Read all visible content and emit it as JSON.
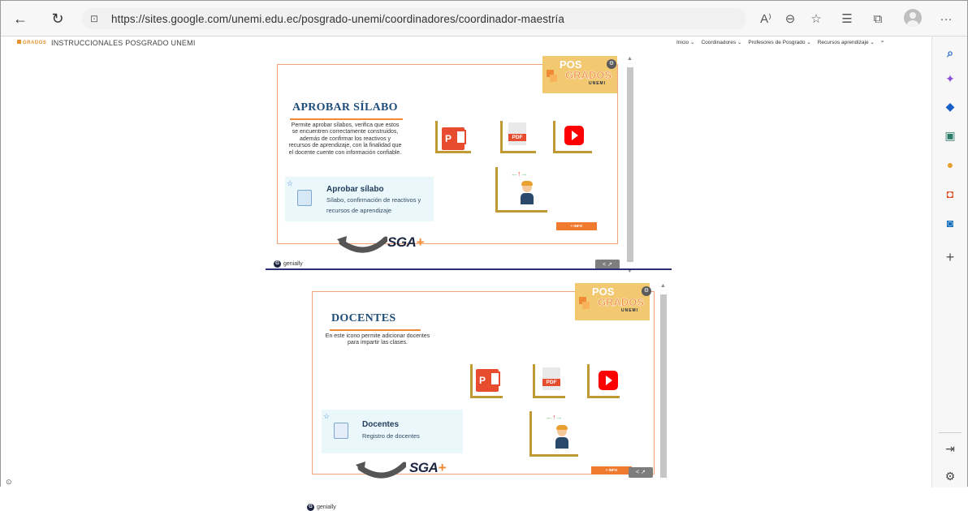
{
  "browser": {
    "url": "https://sites.google.com/unemi.edu.ec/posgrado-unemi/coordinadores/coordinador-maestría",
    "icons": {
      "back": "back-arrow-icon",
      "refresh": "refresh-icon",
      "lock": "lock-icon",
      "read_aloud": "read-aloud-icon",
      "zoom": "zoom-icon",
      "favorite_add": "add-favorite-icon",
      "favorites": "favorites-icon",
      "collections": "collections-icon",
      "profile": "profile-icon",
      "menu": "more-menu-icon"
    },
    "glyphs": {
      "back": "←",
      "refresh": "↻",
      "lock": "⊡",
      "read_aloud": "A⁾",
      "zoom": "⊖",
      "favorite_add": "☆",
      "favorites": "☰",
      "collections": "⧉",
      "menu": "···"
    }
  },
  "site": {
    "logo_text": "GRADOS",
    "name": "INSTRUCCIONALES POSGRADO UNEMI",
    "nav": [
      {
        "label": "Inicio",
        "chevron": "⌄"
      },
      {
        "label": "Coordinadores",
        "chevron": "⌄"
      },
      {
        "label": "Profesores de Posgrado",
        "chevron": "⌄"
      },
      {
        "label": "Recursos aprendizaje",
        "chevron": "⌄"
      }
    ],
    "search_glyph": "⌕"
  },
  "cards": [
    {
      "title": "APROBAR SÍLABO",
      "description": "Permite aprobar sílabos, verifica que estos se encuentren correctamente construidos, además de confirmar los reactivos y recursos de aprendizaje, con la finalidad que el docente cuente con información confiable.",
      "feature_name": "Aprobar sílabo",
      "feature_sub": "Sílabo, confirmación de reactivos y recursos de aprendizaje",
      "brand_pos": "POS",
      "brand_grados": "GRADOS",
      "brand_unemi": "UNEMI",
      "sga": "SGA",
      "sga_plus": "+",
      "info_label": "+ INFO",
      "pdf_label": "PDF",
      "ppt_label": "P",
      "genially": "genially",
      "genially_g": "G",
      "share_glyph": "< ↗",
      "badge_glyph": "⚙"
    },
    {
      "title": "DOCENTES",
      "description": "En este icono permite adicionar docentes para impartir las clases.",
      "feature_name": "Docentes",
      "feature_sub": "Registro de docentes",
      "brand_pos": "POS",
      "brand_grados": "GRADOS",
      "brand_unemi": "UNEMI",
      "sga": "SGA",
      "sga_plus": "+",
      "info_label": "+ INFO",
      "pdf_label": "PDF",
      "ppt_label": "P",
      "genially": "genially",
      "genially_g": "G",
      "share_glyph": "< ↗",
      "badge_glyph": "⚙"
    }
  ],
  "sidebar": {
    "icons": [
      "search-icon",
      "copilot-icon",
      "shopping-tag-icon",
      "tools-icon",
      "games-icon",
      "office-icon",
      "outlook-icon",
      "add-icon",
      "hide-sidebar-icon",
      "settings-icon"
    ],
    "glyphs": [
      "⌕",
      "✦",
      "◆",
      "▣",
      "●",
      "◘",
      "◙",
      "+",
      "⇥",
      "⚙"
    ],
    "colors": {
      "search": "#2b6cc4",
      "copilot": "#8a4fd8",
      "tag": "#1a5fc8",
      "tools": "#2e7d6b",
      "games": "#e8a030",
      "office": "#e34a22",
      "outlook": "#0f6cbd"
    }
  },
  "footer": {
    "page_glyph": "⊙"
  }
}
